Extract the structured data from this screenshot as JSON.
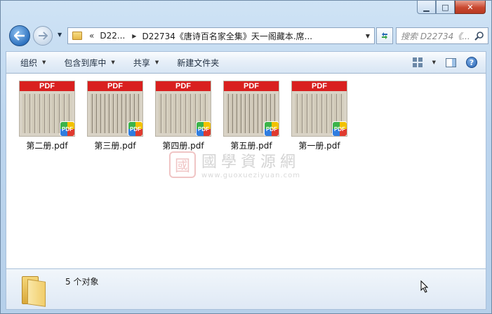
{
  "window": {
    "caption": {
      "minimize": "▁",
      "maximize": "□",
      "close": "✕"
    }
  },
  "nav": {
    "back_icon": "arrow-left-icon",
    "forward_icon": "arrow-right-icon"
  },
  "address": {
    "chevrons": "«",
    "crumbs": [
      "D22...",
      "D22734《唐诗百名家全集》天一阁藏本.席..."
    ]
  },
  "search": {
    "placeholder": "搜索 D22734《..."
  },
  "toolbar": {
    "organize": "组织",
    "include_library": "包含到库中",
    "share": "共享",
    "new_folder": "新建文件夹"
  },
  "files": [
    {
      "name": "第二册.pdf",
      "badge": "PDF",
      "band": "PDF"
    },
    {
      "name": "第三册.pdf",
      "badge": "PDF",
      "band": "PDF"
    },
    {
      "name": "第四册.pdf",
      "badge": "PDF",
      "band": "PDF"
    },
    {
      "name": "第五册.pdf",
      "badge": "PDF",
      "band": "PDF"
    },
    {
      "name": "第一册.pdf",
      "badge": "PDF",
      "band": "PDF"
    }
  ],
  "watermark": {
    "seal": "國",
    "cn": "國學資源網",
    "en": "www.guoxueziyuan.com"
  },
  "details": {
    "status": "5 个对象"
  },
  "colors": {
    "pdf_red": "#d9201f",
    "accent_blue": "#2f73c0"
  }
}
